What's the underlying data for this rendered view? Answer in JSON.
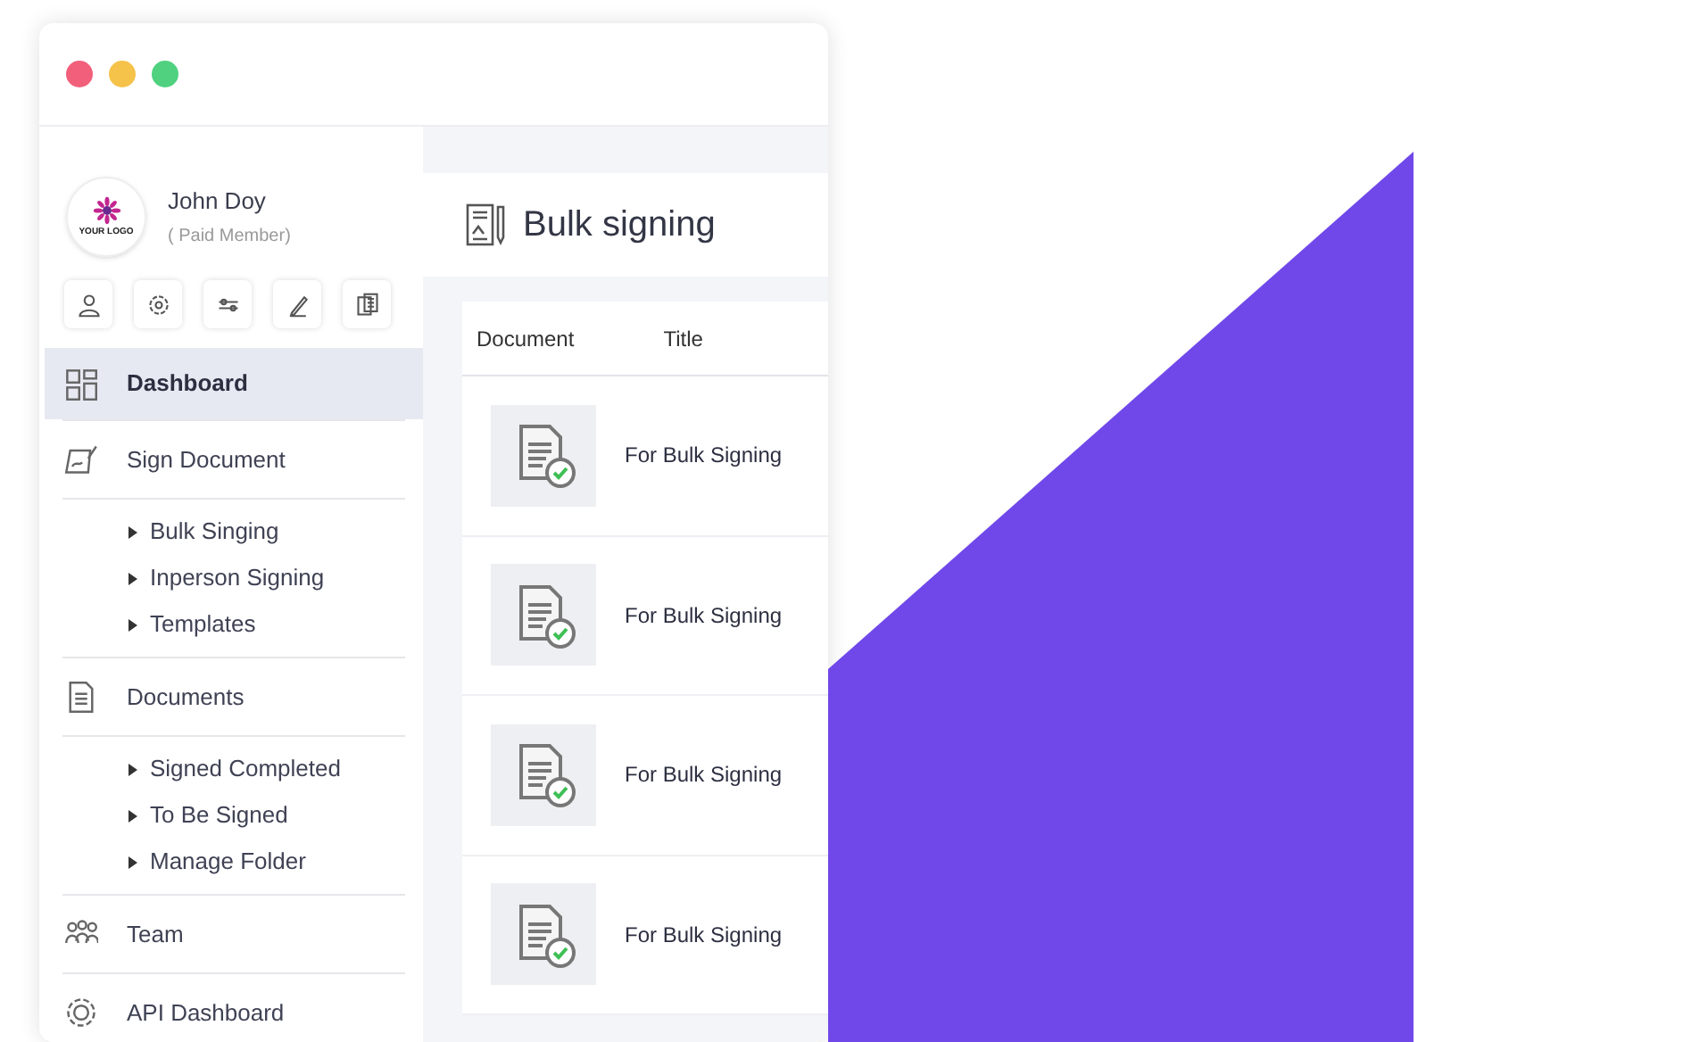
{
  "window": {
    "dots": [
      {
        "color": "#f25f7a"
      },
      {
        "color": "#f5c24a"
      },
      {
        "color": "#4fd17f"
      }
    ]
  },
  "sidebar": {
    "profile": {
      "logo_text": "YOUR LOGO",
      "name": "John Doy",
      "role": "( Paid Member)"
    },
    "nav": [
      {
        "label": "Dashboard",
        "selected": true
      },
      {
        "label": "Sign Document",
        "selected": false,
        "children": [
          {
            "label": "Bulk Singing"
          },
          {
            "label": "Inperson Signing"
          },
          {
            "label": "Templates"
          }
        ]
      },
      {
        "label": "Documents",
        "selected": false,
        "children": [
          {
            "label": "Signed Completed"
          },
          {
            "label": "To Be Signed"
          },
          {
            "label": "Manage Folder"
          }
        ]
      },
      {
        "label": "Team",
        "selected": false
      },
      {
        "label": "API Dashboard",
        "selected": false
      }
    ]
  },
  "main": {
    "title": "Bulk signing",
    "table": {
      "columns": [
        "Document",
        "Title"
      ],
      "rows": [
        {
          "title": "For Bulk Signing"
        },
        {
          "title": "For Bulk Signing"
        },
        {
          "title": "For Bulk Signing"
        },
        {
          "title": "For Bulk Signing"
        }
      ]
    }
  }
}
